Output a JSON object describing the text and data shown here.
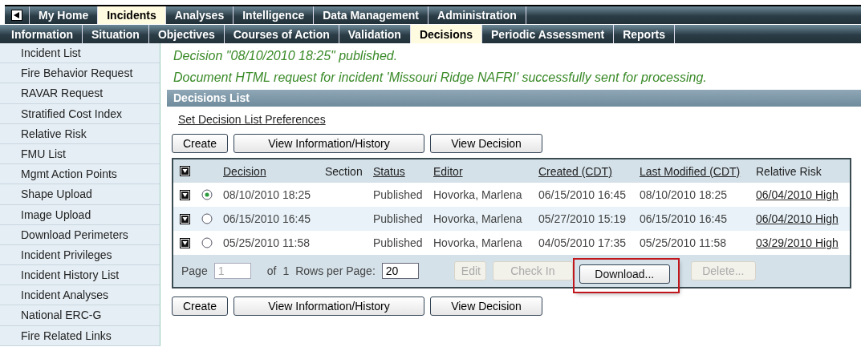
{
  "top_nav": [
    {
      "label": "My Home",
      "selected": false
    },
    {
      "label": "Incidents",
      "selected": true
    },
    {
      "label": "Analyses",
      "selected": false
    },
    {
      "label": "Intelligence",
      "selected": false
    },
    {
      "label": "Data Management",
      "selected": false
    },
    {
      "label": "Administration",
      "selected": false
    }
  ],
  "sub_nav": [
    {
      "label": "Information",
      "selected": false
    },
    {
      "label": "Situation",
      "selected": false
    },
    {
      "label": "Objectives",
      "selected": false
    },
    {
      "label": "Courses of Action",
      "selected": false
    },
    {
      "label": "Validation",
      "selected": false
    },
    {
      "label": "Decisions",
      "selected": true
    },
    {
      "label": "Periodic Assessment",
      "selected": false
    },
    {
      "label": "Reports",
      "selected": false
    }
  ],
  "sidebar": {
    "items": [
      "Incident List",
      "Fire Behavior Request",
      "RAVAR Request",
      "Stratified Cost Index",
      "Relative Risk",
      "FMU List",
      "Mgmt Action Points",
      "Shape Upload",
      "Image Upload",
      "Download Perimeters",
      "Incident Privileges",
      "Incident History List",
      "Incident Analyses",
      "National ERC-G",
      "Fire Related Links"
    ]
  },
  "messages": [
    "Decision \"08/10/2010 18:25\" published.",
    "Document HTML request for incident 'Missouri Ridge NAFRI' successfully sent for processing."
  ],
  "panel_title": "Decisions List",
  "preferences_link": "Set Decision List Preferences",
  "top_buttons": [
    "Create",
    "View Information/History",
    "View Decision"
  ],
  "table": {
    "columns": [
      {
        "label": "Decision",
        "link": true
      },
      {
        "label": "Section",
        "link": false
      },
      {
        "label": "Status",
        "link": true
      },
      {
        "label": "Editor",
        "link": true
      },
      {
        "label": "Created (CDT)",
        "link": true
      },
      {
        "label": "Last Modified (CDT)",
        "link": true
      },
      {
        "label": "Relative Risk",
        "link": false
      }
    ],
    "rows": [
      {
        "selected": true,
        "cells": [
          "08/10/2010 18:25",
          "",
          "Published",
          "Hovorka, Marlena",
          "06/15/2010 16:45",
          "08/10/2010 18:25",
          "06/04/2010 High"
        ]
      },
      {
        "selected": false,
        "cells": [
          "06/15/2010 16:45",
          "",
          "Published",
          "Hovorka, Marlena",
          "05/27/2010 15:19",
          "06/15/2010 16:45",
          "06/04/2010 High"
        ]
      },
      {
        "selected": false,
        "cells": [
          "05/25/2010 11:58",
          "",
          "Published",
          "Hovorka, Marlena",
          "04/05/2010 17:35",
          "05/25/2010 11:58",
          "03/29/2010 High"
        ]
      }
    ]
  },
  "pager": {
    "page_label": "Page",
    "page": "1",
    "of_label": "of",
    "total": "1",
    "rows_label": "Rows per Page:",
    "rows_per_page": "20",
    "buttons": [
      {
        "label": "Edit",
        "disabled": true,
        "highlighted": false
      },
      {
        "label": "Check In",
        "disabled": true,
        "highlighted": false
      },
      {
        "label": "Download...",
        "disabled": false,
        "highlighted": true
      },
      {
        "label": "Delete...",
        "disabled": true,
        "highlighted": false
      }
    ]
  },
  "bottom_buttons": [
    "Create",
    "View Information/History",
    "View Decision"
  ]
}
